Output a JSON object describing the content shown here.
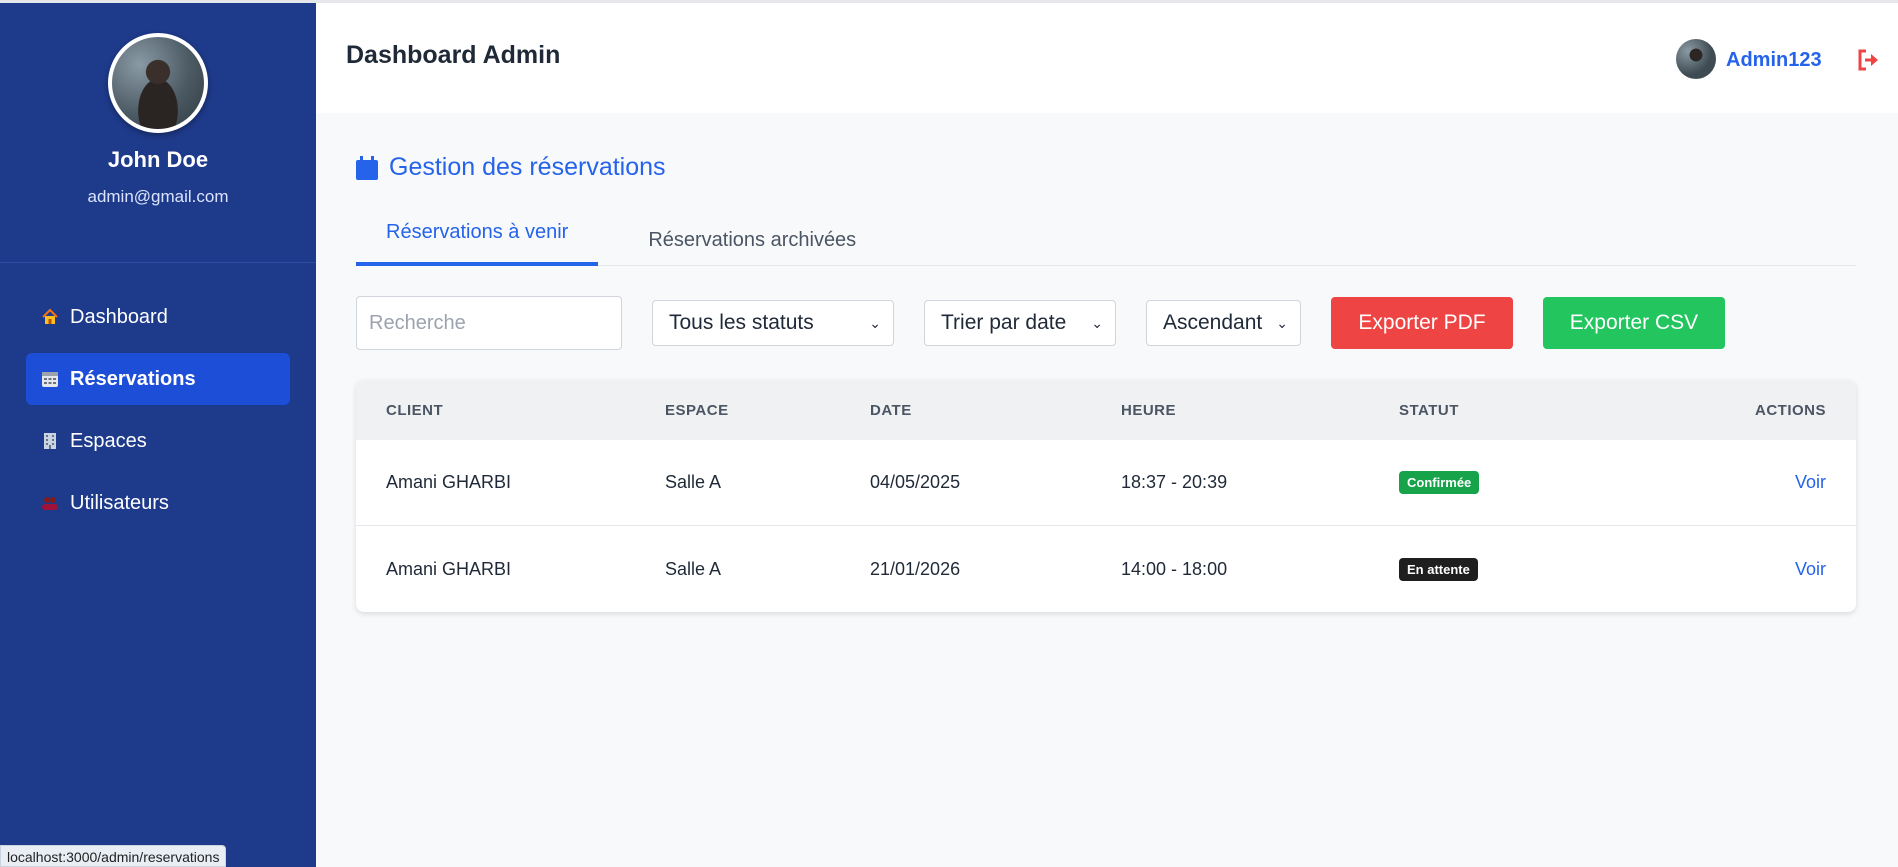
{
  "sidebar": {
    "name": "John Doe",
    "email": "admin@gmail.com",
    "items": [
      {
        "label": "Dashboard",
        "icon": "house-icon"
      },
      {
        "label": "Réservations",
        "icon": "calendar-icon"
      },
      {
        "label": "Espaces",
        "icon": "building-icon"
      },
      {
        "label": "Utilisateurs",
        "icon": "users-icon"
      }
    ],
    "active_index": 1
  },
  "header": {
    "title": "Dashboard Admin",
    "username": "Admin123"
  },
  "main": {
    "section_title": "Gestion des réservations",
    "tabs": [
      "Réservations à venir",
      "Réservations archivées"
    ],
    "search_placeholder": "Recherche",
    "filters": {
      "status": "Tous les statuts",
      "sort": "Trier par date",
      "order": "Ascendant"
    },
    "buttons": {
      "export_pdf": "Exporter PDF",
      "export_csv": "Exporter CSV"
    },
    "table": {
      "headers": [
        "CLIENT",
        "ESPACE",
        "DATE",
        "HEURE",
        "STATUT",
        "ACTIONS"
      ],
      "rows": [
        {
          "client": "Amani GHARBI",
          "espace": "Salle A",
          "date": "04/05/2025",
          "heure": "18:37 - 20:39",
          "statut": "Confirmée",
          "action": "Voir"
        },
        {
          "client": "Amani GHARBI",
          "espace": "Salle A",
          "date": "21/01/2026",
          "heure": "14:00 - 18:00",
          "statut": "En attente",
          "action": "Voir"
        }
      ]
    }
  },
  "status_bar": {
    "url": "localhost:3000/admin/reservations"
  },
  "colors": {
    "sidebar_bg": "#1e3a8a",
    "accent": "#2563eb",
    "danger": "#ef4444",
    "success": "#22c55e"
  }
}
